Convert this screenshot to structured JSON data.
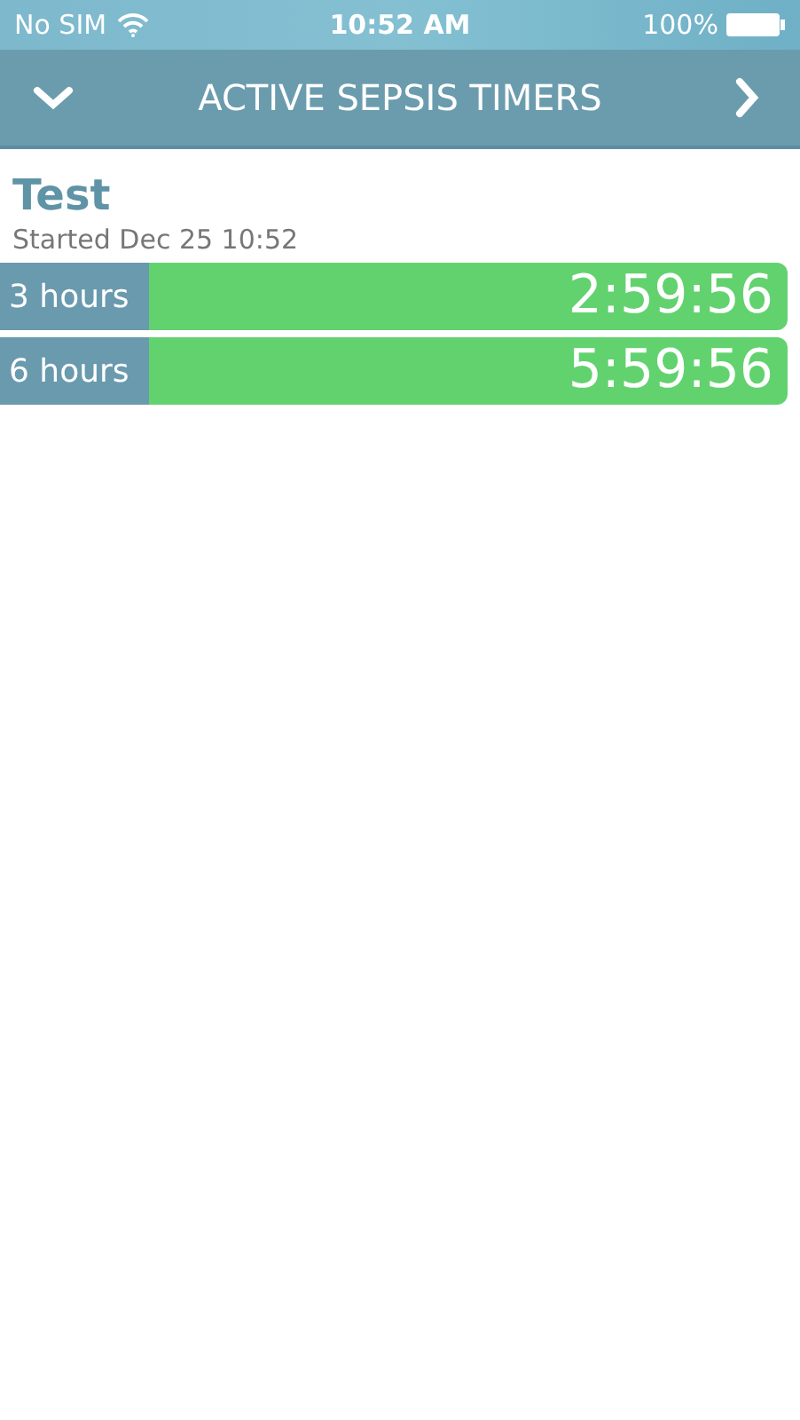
{
  "status_bar": {
    "carrier": "No SIM",
    "time": "10:52 AM",
    "battery": "100%"
  },
  "nav_bar": {
    "title": "ACTIVE SEPSIS TIMERS"
  },
  "patient": {
    "name": "Test",
    "started": "Started Dec 25 10:52"
  },
  "timers": [
    {
      "label": "3 hours",
      "remaining": "2:59:56",
      "color": "#62d26f"
    },
    {
      "label": "6 hours",
      "remaining": "5:59:56",
      "color": "#62d26f"
    }
  ]
}
